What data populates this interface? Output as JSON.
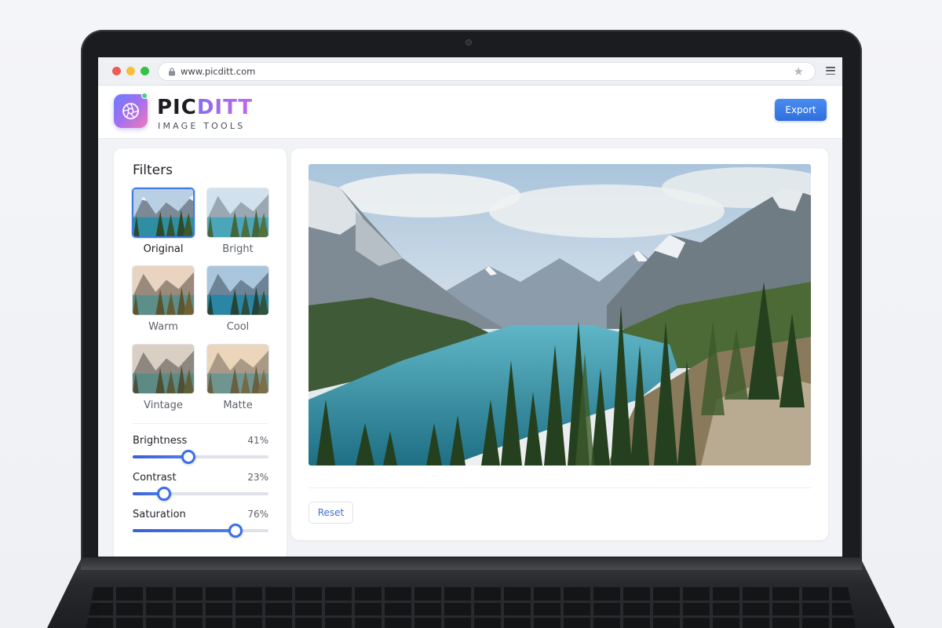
{
  "browser": {
    "url": "www.picditt.com"
  },
  "header": {
    "brand_part1": "PIC",
    "brand_part2": "DITT",
    "tagline": "IMAGE TOOLS",
    "export_label": "Export"
  },
  "sidebar": {
    "title": "Filters",
    "filters": [
      {
        "label": "Original",
        "selected": true
      },
      {
        "label": "Bright",
        "selected": false
      },
      {
        "label": "Warm",
        "selected": false
      },
      {
        "label": "Cool",
        "selected": false
      },
      {
        "label": "Vintage",
        "selected": false
      },
      {
        "label": "Matte",
        "selected": false
      }
    ],
    "sliders": [
      {
        "label": "Brightness",
        "value_text": "41%",
        "value": 0.41
      },
      {
        "label": "Contrast",
        "value_text": "23%",
        "value": 0.23
      },
      {
        "label": "Saturation",
        "value_text": "76%",
        "value": 0.76
      }
    ]
  },
  "canvas": {
    "reset_label": "Reset"
  },
  "colors": {
    "accent": "#3f7be8",
    "export_button": "#3a7ee6",
    "brand_gradient_start": "#8a6df0",
    "brand_gradient_end": "#c168e6"
  },
  "icons": {
    "logo": "camera-aperture-icon",
    "lock": "lock-icon",
    "bookmark": "star-icon",
    "menu": "hamburger-menu-icon"
  }
}
